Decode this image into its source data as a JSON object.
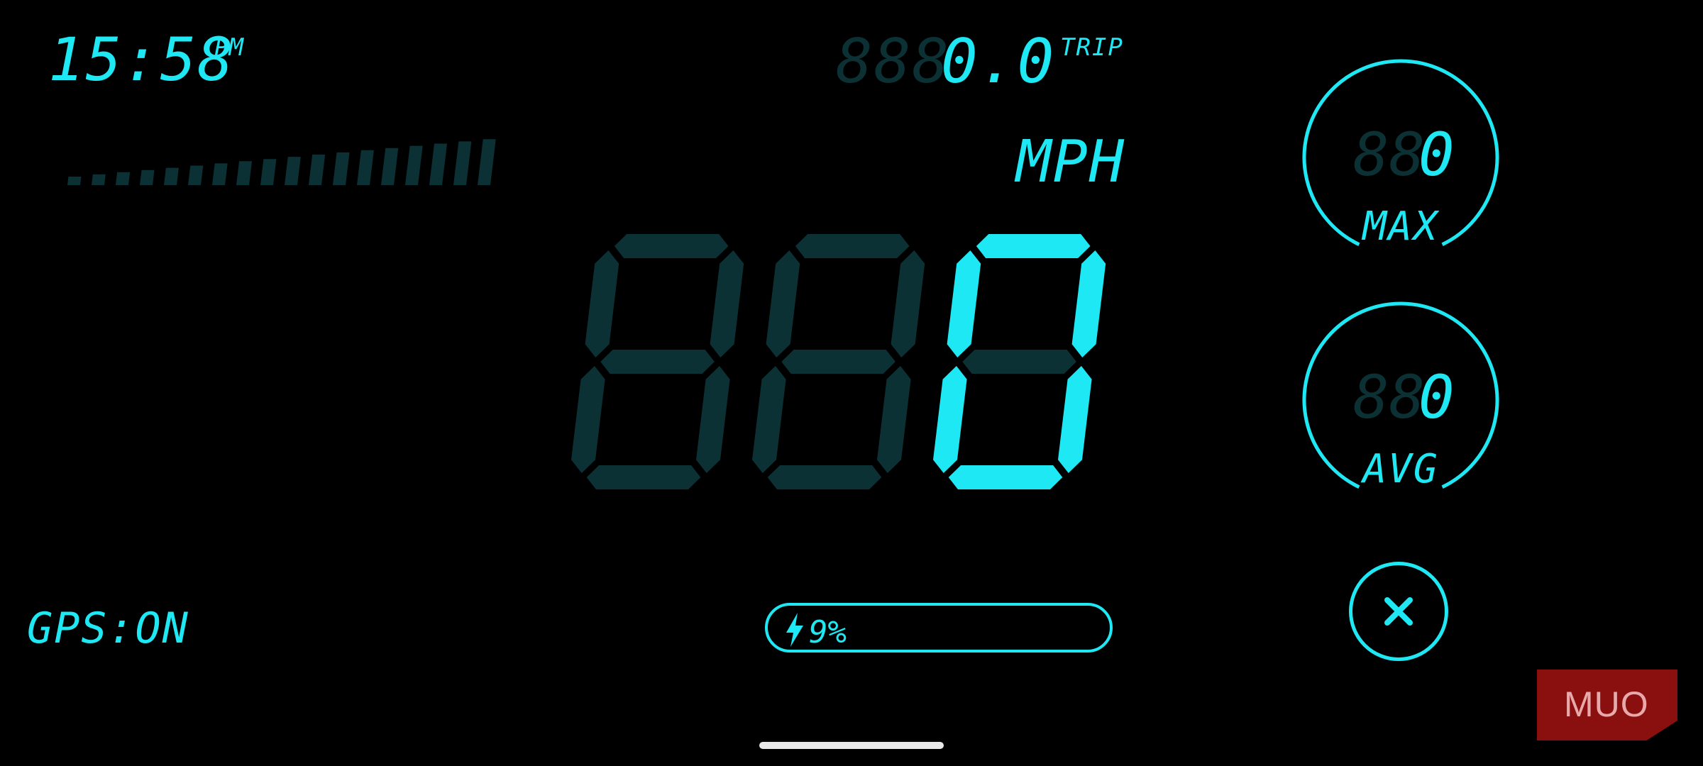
{
  "clock": {
    "time": "15:58",
    "ampm": "PM"
  },
  "trip": {
    "ghost": "888",
    "value": "0.0",
    "label": "TRIP"
  },
  "speed": {
    "ghost_digits": 2,
    "value": "0",
    "unit": "MPH"
  },
  "speed_bars": {
    "count": 18,
    "level": 0
  },
  "max": {
    "ghost": "88",
    "value": "0",
    "label": "MAX"
  },
  "avg": {
    "ghost": "88",
    "value": "0",
    "label": "AVG"
  },
  "battery": {
    "percent": "9%",
    "level": 0.09
  },
  "gps": {
    "status": "GPS:ON"
  },
  "close": {
    "icon": "close-icon"
  },
  "watermark": {
    "text": "MUO"
  },
  "colors": {
    "active": "#1ee8f4",
    "ghost": "#0c3134",
    "background": "#000000",
    "watermark": "#8a1010"
  }
}
